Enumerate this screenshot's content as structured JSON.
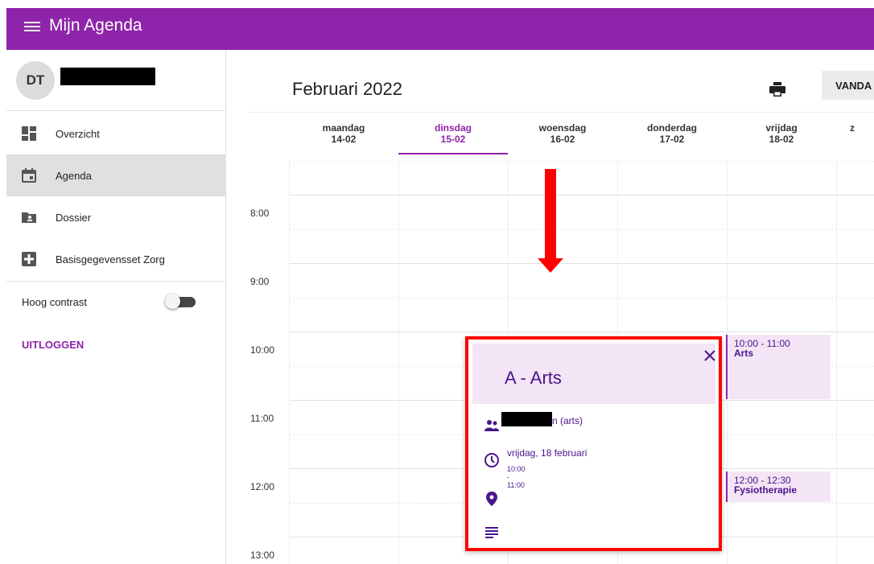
{
  "app": {
    "title": "Mijn Agenda"
  },
  "user": {
    "initials": "DT"
  },
  "sidebar": {
    "items": [
      {
        "label": "Overzicht",
        "icon": "dashboard-icon"
      },
      {
        "label": "Agenda",
        "icon": "calendar-icon",
        "active": true
      },
      {
        "label": "Dossier",
        "icon": "folder-user-icon"
      },
      {
        "label": "Basisgegevensset Zorg",
        "icon": "medical-plus-icon"
      }
    ],
    "contrast_label": "Hoog contrast",
    "logout_label": "UITLOGGEN"
  },
  "calendar": {
    "month_title": "Februari 2022",
    "today_button": "VANDA",
    "days": [
      {
        "name": "maandag",
        "date": "14-02"
      },
      {
        "name": "dinsdag",
        "date": "15-02",
        "active": true
      },
      {
        "name": "woensdag",
        "date": "16-02"
      },
      {
        "name": "donderdag",
        "date": "17-02"
      },
      {
        "name": "vrijdag",
        "date": "18-02"
      },
      {
        "name": "z",
        "date": ""
      }
    ],
    "hours": [
      "8:00",
      "9:00",
      "10:00",
      "11:00",
      "12:00",
      "13:00"
    ],
    "events": [
      {
        "time": "10:00 - 11:00",
        "title": "Arts"
      },
      {
        "time": "12:00 - 12:30",
        "title": "Fysiotherapie"
      }
    ]
  },
  "popup": {
    "title": "A - Arts",
    "participant_suffix": "n (arts)",
    "date": "vrijdag, 18 februari",
    "time": "10:00 - 11:00"
  },
  "colors": {
    "primary": "#8e24aa",
    "event_bg": "#f3e5f5",
    "annotation": "#ff0000"
  }
}
